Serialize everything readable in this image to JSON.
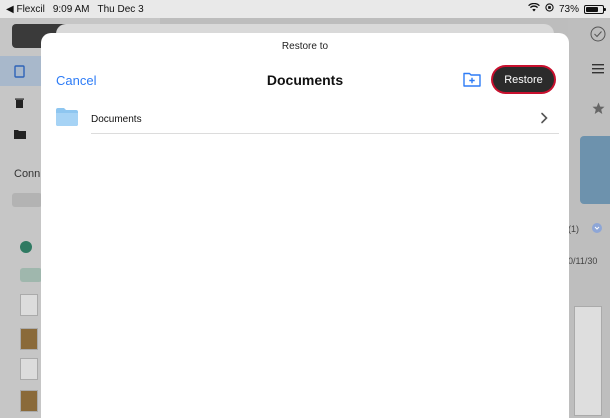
{
  "status_bar": {
    "app": "Flexcil",
    "time": "9:09 AM",
    "date": "Thu Dec 3",
    "battery": "73%",
    "battery_level": 0.73
  },
  "background": {
    "section_label": "Conn",
    "badge_text": "(1)",
    "date_text": "0/11/30"
  },
  "sheet": {
    "title": "Restore to",
    "nav_title": "Documents",
    "cancel_label": "Cancel",
    "restore_label": "Restore",
    "folders": [
      {
        "label": "Documents"
      }
    ]
  },
  "colors": {
    "accent": "#2e7cf6",
    "restore_bg": "#2b2b2b",
    "highlight": "#c8102e",
    "folder": "#8ec6f0"
  }
}
